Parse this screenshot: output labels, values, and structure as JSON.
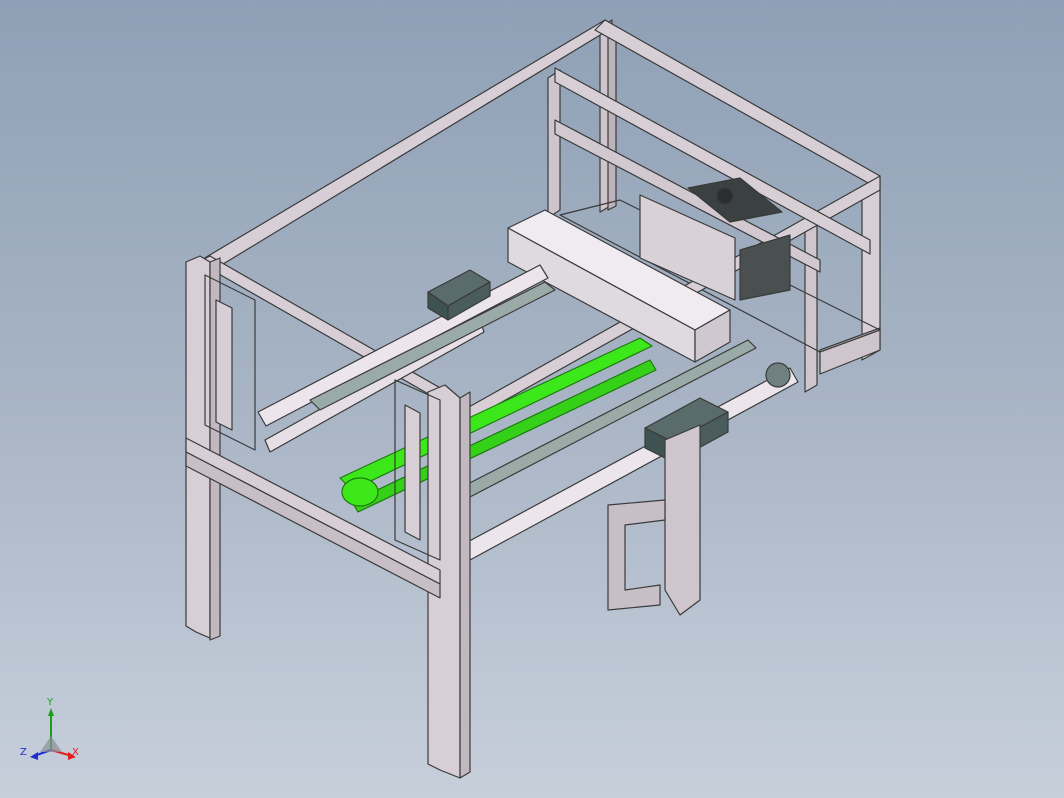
{
  "viewport": {
    "background_top": "#8fa0b6",
    "background_bottom": "#c7cfdb"
  },
  "model": {
    "frame_color": "#d8cfd6",
    "frame_edge_color": "#3a3a3a",
    "belt_color": "#3de81a",
    "rail_color": "#9aaaa6",
    "bearing_block_color": "#3f5252",
    "shaft_color": "#ece6ec"
  },
  "triad": {
    "x_label": "X",
    "y_label": "Y",
    "z_label": "Z",
    "x_color": "#e02020",
    "y_color": "#18a018",
    "z_color": "#2030d0"
  }
}
